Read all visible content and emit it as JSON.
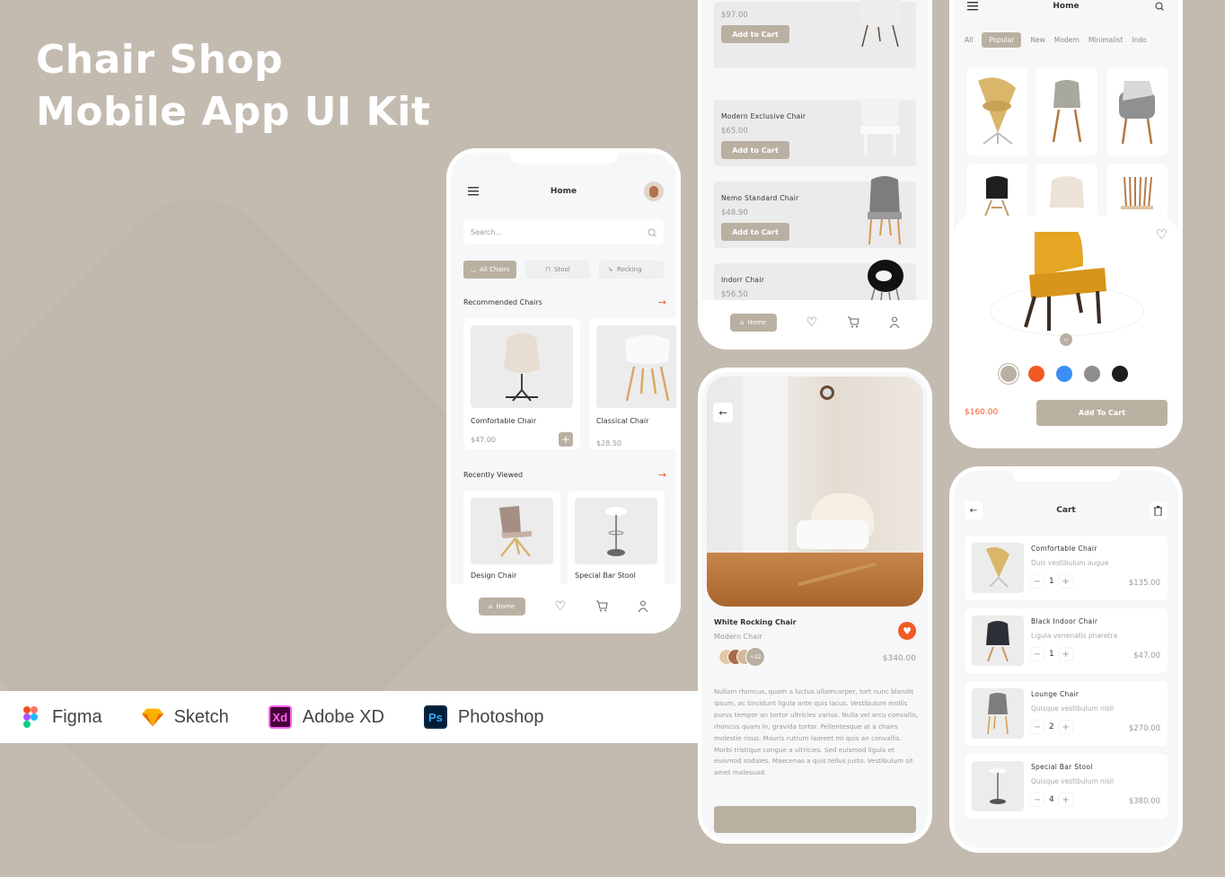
{
  "hero": {
    "line1": "Chair Shop",
    "line2": "Mobile App UI Kit"
  },
  "tools": [
    {
      "name": "Figma",
      "icon": "figma-icon"
    },
    {
      "name": "Sketch",
      "icon": "sketch-icon"
    },
    {
      "name": "Adobe XD",
      "icon": "adobe-xd-icon",
      "glyph": "Xd"
    },
    {
      "name": "Photoshop",
      "icon": "photoshop-icon",
      "glyph": "Ps"
    }
  ],
  "colors": {
    "accent": "#bab0a2",
    "orange": "#f15a24",
    "background": "#c3bbb0"
  },
  "home": {
    "title": "Home",
    "search_placeholder": "Search...",
    "categories": [
      "All Chairs",
      "Stool",
      "Rocking"
    ],
    "recommended_title": "Recommended Chairs",
    "recommended": [
      {
        "name": "Comfortable Chair",
        "price": "$47.00"
      },
      {
        "name": "Classical Chair",
        "price": "$28.50"
      }
    ],
    "recent_title": "Recently Viewed",
    "recent": [
      {
        "name": "Design Chair"
      },
      {
        "name": "Special Bar Stool"
      }
    ],
    "nav_home": "Home"
  },
  "list": {
    "items": [
      {
        "name": "",
        "price": "$97.00",
        "button": "Add to Cart"
      },
      {
        "name": "Modern Exclusive Chair",
        "price": "$65.00",
        "button": "Add to Cart"
      },
      {
        "name": "Nemo Standard Chair",
        "price": "$48.90",
        "button": "Add to Cart"
      },
      {
        "name": "Indorr Chair",
        "price": "$56.50",
        "button": "Add to Cart"
      }
    ],
    "nav_home": "Home"
  },
  "detail": {
    "name": "White Rocking Chair",
    "category": "Modern Chair",
    "reviewers_extra": "+22",
    "price": "$340.00",
    "description": "Nullam rhoncus, quam a luctus ullamcorper, tort nunc blandit ipsum, ac tincidunt ligula ante quis lacus. Vestibulum mollis purus tempor an tortor ultricies varius. Nulla vel arcu convallis, rhoncus quam in, gravida tortor. Pellentesque at a chairs molestie risus. Mauris rutrum laoreet mi quis an convallis. Morbi tristique congue a ultricies. Sed euismod ligula et euismod sodales. Maecenas a quis tellus justo. Vestibulum sit amet malesuad."
  },
  "browse": {
    "title": "Home",
    "filters": [
      "All",
      "Popular",
      "New",
      "Modern",
      "Minimalist",
      "Indo"
    ],
    "active_filter": "Popular"
  },
  "product": {
    "price": "$160.00",
    "button": "Add To Cart",
    "swatches": [
      "#bab0a2",
      "#f15a24",
      "#3b8ff5",
      "#8e8e8e",
      "#1e1e1e"
    ]
  },
  "cart": {
    "title": "Cart",
    "items": [
      {
        "name": "Comfortable Chair",
        "desc": "Duis vestibulum augue",
        "qty": "1",
        "price": "$135.00"
      },
      {
        "name": "Black Indoor Chair",
        "desc": "Ligula venenatis pharetra",
        "qty": "1",
        "price": "$47.00"
      },
      {
        "name": "Lounge Chair",
        "desc": "Quisque vestibulum nisli",
        "qty": "2",
        "price": "$270.00"
      },
      {
        "name": "Special Bar Stool",
        "desc": "Quisque vestibulum nisli",
        "qty": "4",
        "price": "$380.00"
      }
    ]
  }
}
